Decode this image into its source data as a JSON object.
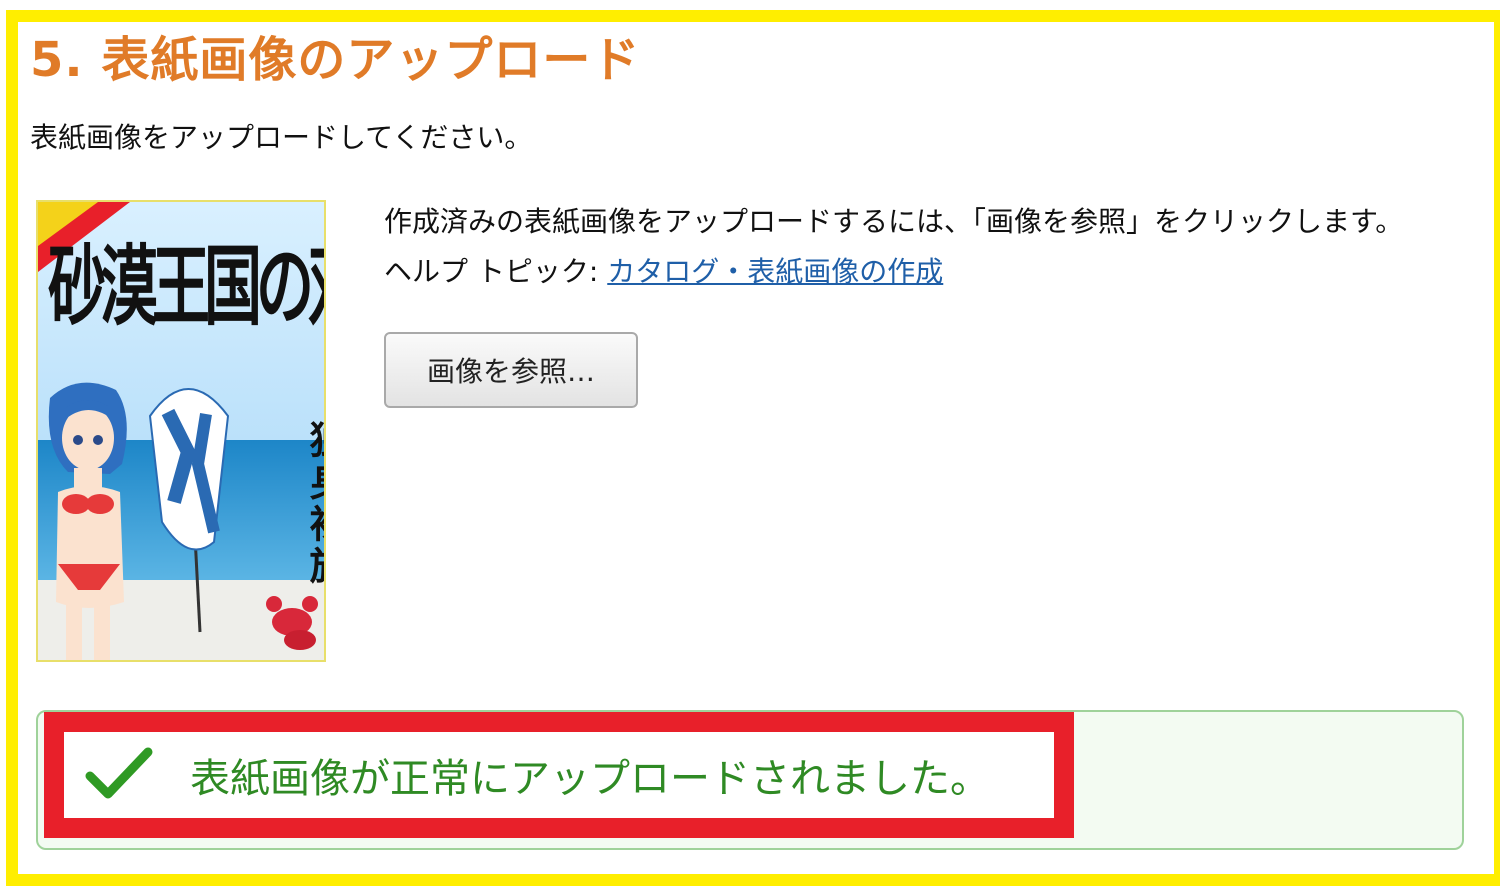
{
  "section": {
    "title": "5. 表紙画像のアップロード",
    "instruction": "表紙画像をアップロードしてください。"
  },
  "cover": {
    "title": "砂漠王国の双月姫",
    "author": "独身裸族"
  },
  "description": "作成済みの表紙画像をアップロードするには、「画像を参照」をクリックします。",
  "help": {
    "prefix": "ヘルプ トピック: ",
    "link_label": "カタログ・表紙画像の作成"
  },
  "browse_button_label": "画像を参照…",
  "success_message": "表紙画像が正常にアップロードされました。",
  "colors": {
    "frame_highlight": "#ffee00",
    "title": "#e07b28",
    "link": "#1f5fa8",
    "success_text": "#2f8a24",
    "success_border": "#9fd29a",
    "callout_red": "#e8202a"
  }
}
